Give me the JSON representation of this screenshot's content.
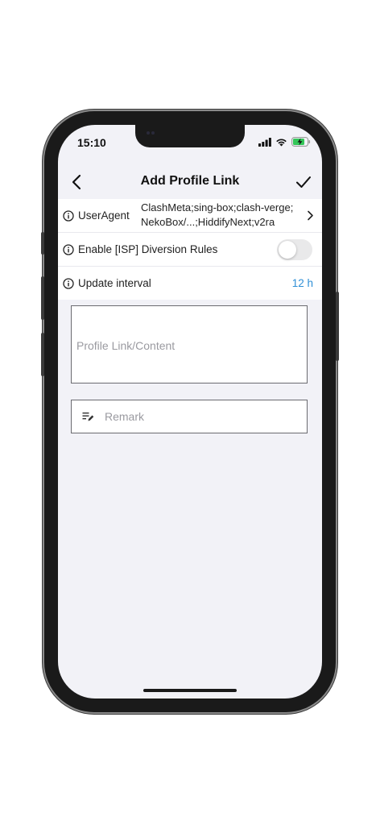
{
  "status_bar": {
    "time": "15:10",
    "icons": [
      "signal-icon",
      "wifi-icon",
      "battery-charging-icon"
    ],
    "battery_color": "#34c759"
  },
  "nav": {
    "title": "Add Profile Link",
    "back_icon": "chevron-left-icon",
    "done_icon": "checkmark-icon"
  },
  "settings": {
    "user_agent": {
      "label": "UserAgent",
      "value": "ClashMeta;sing-box;clash-verge;NekoBox/...;HiddifyNext;v2ra"
    },
    "isp_diversion": {
      "label": "Enable [ISP] Diversion Rules",
      "enabled": false
    },
    "update_interval": {
      "label": "Update interval",
      "value": "12 h"
    }
  },
  "form": {
    "link_placeholder": "Profile Link/Content",
    "remark_placeholder": "Remark",
    "remark_icon": "edit-notes-icon"
  },
  "colors": {
    "accent": "#2f8fd6",
    "background": "#f2f2f7"
  }
}
